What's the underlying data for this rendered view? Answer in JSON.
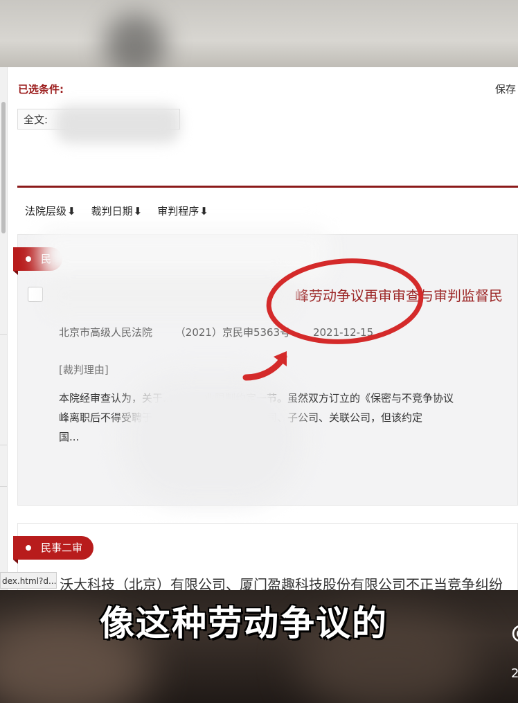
{
  "filters": {
    "title": "已选条件:",
    "save_label": "保存",
    "fulltext_label": "全文:"
  },
  "sort": {
    "items": [
      {
        "label": "法院层级",
        "arrow": "⬇",
        "active": true
      },
      {
        "label": "裁判日期",
        "arrow": "⬇",
        "active": false
      },
      {
        "label": "审判程序",
        "arrow": "⬇",
        "active": false
      }
    ]
  },
  "results": [
    {
      "ribbon": "民",
      "title": "峰劳动争议再审审查与审判监督民",
      "court": "北京市高级人民法院",
      "case_no": "（2021）京民申5363号",
      "date": "2021-12-15",
      "reason_label": "[裁判理由]",
      "summary_lines": [
        "本院经审查认为，关于…………业限制约定一节。虽然双方订立的《保密与不竞争协议",
        "峰离职后不得受聘于…………关的公司的分公司、子公司、关联公司，但该约定",
        "国..."
      ]
    },
    {
      "ribbon": "民事二审",
      "title": "沃大科技（北京）有限公司、厦门盈趣科技股份有限公司不正当竞争纠纷"
    }
  ],
  "status_url": "dex.html?d...",
  "caption": "像这种劳动争议的",
  "edge_glyph": "@",
  "edge_num": "2",
  "colors": {
    "accent": "#9b1b1b",
    "ribbon": "#b81c1c",
    "annotation": "#d42a2a"
  }
}
